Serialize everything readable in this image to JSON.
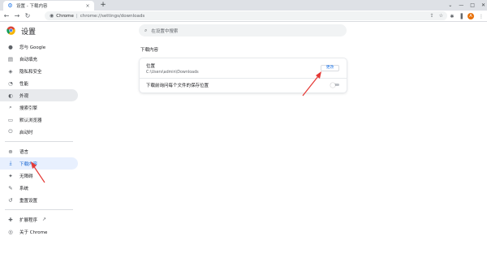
{
  "tab": {
    "title": "设置 - 下载内容",
    "close": "×",
    "new_tab": "+"
  },
  "window_controls": {
    "dropdown": "⌄",
    "minimize": "—",
    "maximize": "□",
    "close": "✕"
  },
  "omnibox": {
    "site_label": "Chrome",
    "separator": "|",
    "url": "chrome://settings/downloads"
  },
  "toolbar": {
    "back": "←",
    "forward": "→",
    "reload": "↻",
    "avatar_letter": "A"
  },
  "header": {
    "title": "设置"
  },
  "search": {
    "placeholder": "在设置中搜索"
  },
  "sidebar": {
    "items": [
      {
        "label": "您与 Google",
        "icon": "person-icon"
      },
      {
        "label": "自动填充",
        "icon": "autofill-icon"
      },
      {
        "label": "隐私和安全",
        "icon": "shield-icon"
      },
      {
        "label": "性能",
        "icon": "speed-icon"
      },
      {
        "label": "外观",
        "icon": "palette-icon"
      },
      {
        "label": "搜索引擎",
        "icon": "search-icon"
      },
      {
        "label": "默认浏览器",
        "icon": "browser-icon"
      },
      {
        "label": "启动时",
        "icon": "power-icon"
      },
      {
        "label": "语言",
        "icon": "globe-icon"
      },
      {
        "label": "下载内容",
        "icon": "download-icon"
      },
      {
        "label": "无障碍",
        "icon": "accessibility-icon"
      },
      {
        "label": "系统",
        "icon": "wrench-icon"
      },
      {
        "label": "重置设置",
        "icon": "reset-icon"
      },
      {
        "label": "扩展程序",
        "icon": "puzzle-icon"
      },
      {
        "label": "关于 Chrome",
        "icon": "chrome-icon"
      }
    ]
  },
  "downloads": {
    "section_title": "下载内容",
    "location_label": "位置",
    "location_path": "C:\\Users\\admin\\Downloads",
    "change_button": "更改",
    "ask_label": "下载前询问每个文件的保存位置",
    "ask_enabled": false
  },
  "colors": {
    "accent": "#1a73e8",
    "active_bg": "#e8f0fe",
    "annotation": "#e53935"
  }
}
